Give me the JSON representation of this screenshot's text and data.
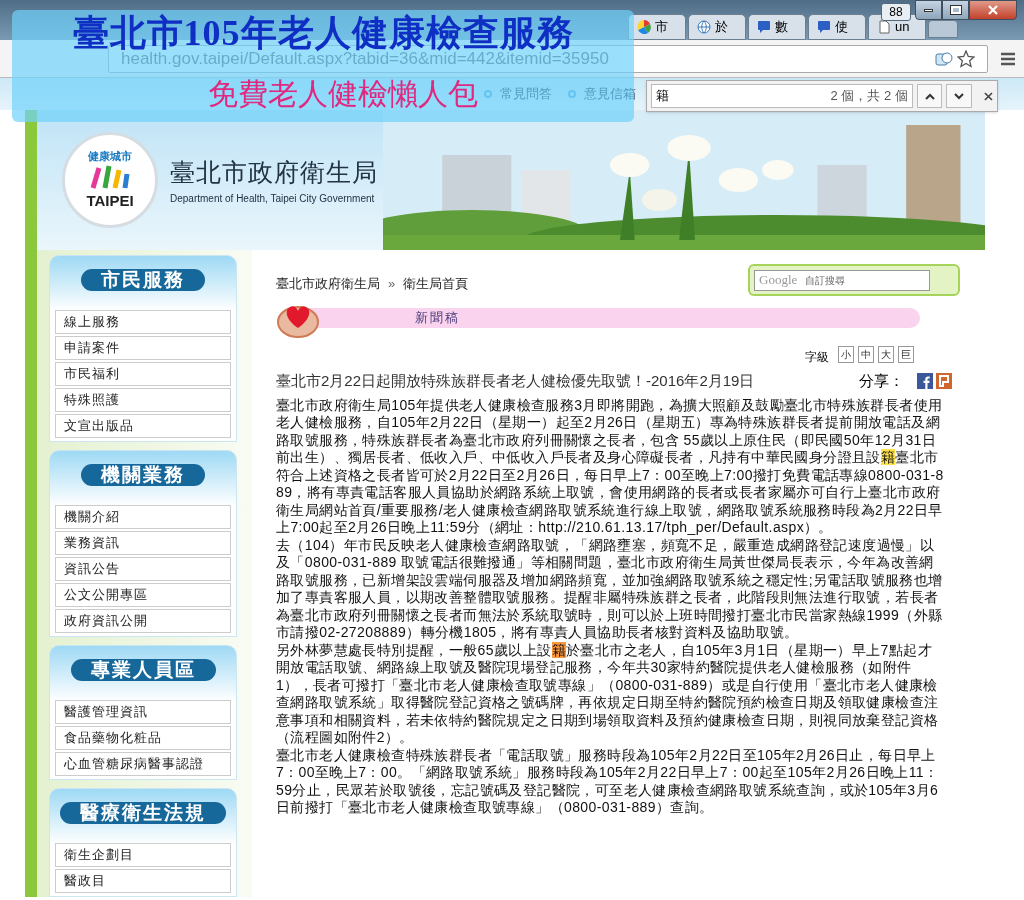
{
  "browser": {
    "badge": "88",
    "tabs": [
      {
        "label": "市",
        "kind": "colorwheel",
        "selected": false
      },
      {
        "label": "於",
        "kind": "globe",
        "selected": false
      },
      {
        "label": "數",
        "kind": "chat",
        "selected": false
      },
      {
        "label": "使",
        "kind": "chat",
        "selected": false
      },
      {
        "label": "un",
        "kind": "page",
        "selected": false
      }
    ],
    "address": "health.gov.taipei/Default.aspx?tabid=36&mid=442&itemid=35950",
    "find_bar": {
      "query": "籍",
      "count": "2 個，共 2 個"
    }
  },
  "overlay": {
    "title": "臺北市105年老人健康檢查服務",
    "subtitle": "免費老人健檢懶人包"
  },
  "site": {
    "nav": [
      "常見問答",
      "意見信箱"
    ],
    "logo_caption": "健康城市",
    "logo_text": "TAIPEI",
    "agency_name": "臺北市政府衛生局",
    "agency_english": "Department of Health, Taipei City Government"
  },
  "sidebar": [
    {
      "title": "市民服務",
      "items": [
        "線上服務",
        "申請案件",
        "市民福利",
        "特殊照護",
        "文宣出版品"
      ]
    },
    {
      "title": "機關業務",
      "items": [
        "機關介紹",
        "業務資訊",
        "資訊公告",
        "公文公開專區",
        "政府資訊公開"
      ]
    },
    {
      "title": "專業人員區",
      "items": [
        "醫護管理資訊",
        "食品藥物化粧品",
        "心血管糖尿病醫事認證"
      ]
    },
    {
      "title": "醫療衛生法規",
      "items": [
        "衛生企劃目",
        "醫政目"
      ]
    }
  ],
  "breadcrumb": {
    "items": [
      "臺北市政府衛生局",
      "衛生局首頁"
    ],
    "separator": "»"
  },
  "search": {
    "brand": "Google",
    "placeholder": "自訂搜尋"
  },
  "section_title": "新聞稿",
  "font_size": {
    "label": "字級",
    "options": [
      "小",
      "中",
      "大",
      "巨"
    ]
  },
  "article": {
    "title": "臺北市2月22日起開放特殊族群長者老人健檢優先取號！-2016年2月19日",
    "share_label": "分享：",
    "paragraphs": [
      [
        {
          "text": "臺北市政府衛生局105年提供老人健康檢查服務3月即將開跑，為擴大照顧及鼓勵臺北市特殊族群長者使用老人健檢服務，自105年2月22日（星期一）起至2月26日（星期五）專為特殊族群長者提前開放電話及網路取號服務，特殊族群長者為臺北市政府列冊關懷之長者，包含 55歲以上原住民（即民國50年12月31日前出生）、獨居長者、低收入戶、中低收入戶長者及身心障礙長者，凡持有中華民國身分證且設"
        },
        {
          "text": "籍",
          "kind": "match",
          "current": false
        },
        {
          "text": "臺北市符合上述資格之長者皆可於2月22日至2月26日，每日早上7：00至晚上7:00撥打免費電話專線0800-031-889，將有專責電話客服人員協助於網路系統上取號，會使用網路的長者或長者家屬亦可自行上臺北市政府衛生局網站首頁/重要服務/老人健康檢查網路取號系統進行線上取號，網路取號系統服務時段為2月22日早上7:00起至2月26日晚上11:59分（網址：http://210.61.13.17/tph_per/Default.aspx）。"
        }
      ],
      [
        {
          "text": "去（104）年市民反映老人健康檢查網路取號，「網路壅塞，頻寬不足，嚴重造成網路登記速度過慢」以及「0800-031-889 取號電話很難撥通」等相關問題，臺北市政府衛生局黃世傑局長表示，今年為改善網路取號服務，已新增架設雲端伺服器及增加網路頻寬，並加強網路取號系統之穩定性;另電話取號服務也增加了專責客服人員，以期改善整體取號服務。提醒非屬特殊族群之長者，此階段則無法進行取號，若長者為臺北市政府列冊關懷之長者而無法於系統取號時，則可以於上班時間撥打臺北市民當家熱線1999（外縣市請撥02-27208889）轉分機1805，將有專責人員協助長者核對資料及協助取號。"
        }
      ],
      [
        {
          "text": "另外林夢慧處長特別提醒，一般65歲以上設"
        },
        {
          "text": "籍",
          "kind": "match",
          "current": true
        },
        {
          "text": "於臺北市之老人，自105年3月1日（星期一）早上7點起才開放電話取號、網路線上取號及醫院現場登記服務，今年共30家特約醫院提供老人健檢服務（如附件1），長者可撥打「臺北市老人健康檢查取號專線」（0800-031-889）或是自行使用「臺北市老人健康檢查網路取號系統」取得醫院登記資格之號碼牌，再依規定日期至特約醫院預約檢查日期及領取健康檢查注意事項和相關資料，若未依特約醫院規定之日期到場領取資料及預約健康檢查日期，則視同放棄登記資格（流程圖如附件2）。"
        }
      ],
      [
        {
          "text": "臺北市老人健康檢查特殊族群長者「電話取號」服務時段為105年2月22日至105年2月26日止，每日早上7：00至晚上7：00。「網路取號系統」服務時段為105年2月22日早上7：00起至105年2月26日晚上11：59分止，民眾若於取號後，忘記號碼及登記醫院，可至老人健康檢查網路取號系統查詢，或於105年3月6日前撥打「臺北市老人健康檢查取號專線」（0800-031-889）查詢。"
        }
      ]
    ]
  }
}
